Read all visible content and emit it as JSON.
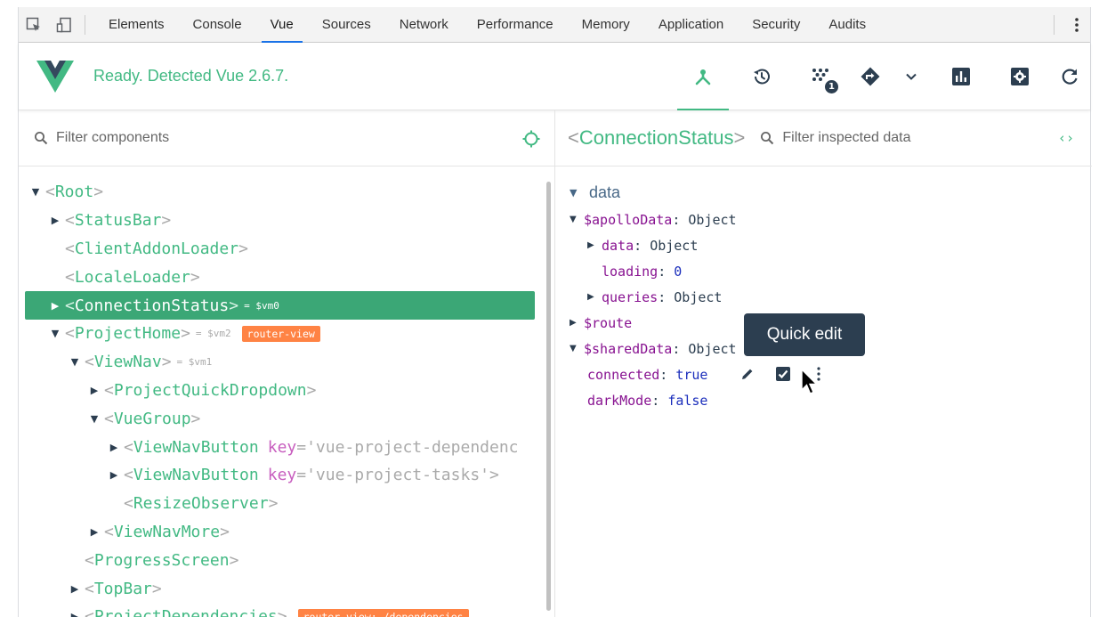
{
  "devtools": {
    "tabs": [
      {
        "label": "Elements"
      },
      {
        "label": "Console"
      },
      {
        "label": "Vue"
      },
      {
        "label": "Sources"
      },
      {
        "label": "Network"
      },
      {
        "label": "Performance"
      },
      {
        "label": "Memory"
      },
      {
        "label": "Application"
      },
      {
        "label": "Security"
      },
      {
        "label": "Audits"
      }
    ],
    "active_tab": "Vue"
  },
  "vue_toolbar": {
    "status": "Ready. Detected Vue 2.6.7.",
    "events_badge": "1",
    "accent": "#42b983"
  },
  "components": {
    "filter_placeholder": "Filter components",
    "tree": [
      {
        "name": "Root",
        "expanded": true
      },
      {
        "name": "StatusBar",
        "expanded": false
      },
      {
        "name": "ClientAddonLoader"
      },
      {
        "name": "LocaleLoader"
      },
      {
        "name": "ConnectionStatus",
        "expanded": false,
        "selected": true,
        "vm": "= $vm0"
      },
      {
        "name": "ProjectHome",
        "expanded": true,
        "vm": "= $vm2",
        "chip": "router-view"
      },
      {
        "name": "ViewNav",
        "expanded": true,
        "vm": "= $vm1"
      },
      {
        "name": "ProjectQuickDropdown",
        "expanded": false
      },
      {
        "name": "VueGroup",
        "expanded": true
      },
      {
        "name": "ViewNavButton",
        "expanded": false,
        "key": "key",
        "key_value": "='vue-project-dependenc"
      },
      {
        "name": "ViewNavButton",
        "expanded": false,
        "key": "key",
        "key_value": "='vue-project-tasks'"
      },
      {
        "name": "ResizeObserver"
      },
      {
        "name": "ViewNavMore",
        "expanded": false
      },
      {
        "name": "ProgressScreen"
      },
      {
        "name": "TopBar",
        "expanded": false
      },
      {
        "name": "ProjectDependencies",
        "expanded": false,
        "chip": "router-view: /dependencies"
      }
    ]
  },
  "inspector": {
    "component_name": "ConnectionStatus",
    "filter_placeholder": "Filter inspected data",
    "section": "data",
    "apollo_key": "$apolloData",
    "apollo_value": "Object",
    "apollo_children": [
      {
        "key": "data",
        "value": "Object"
      },
      {
        "key": "loading",
        "value": "0"
      },
      {
        "key": "queries",
        "value": "Object"
      }
    ],
    "route_key": "$route",
    "shared_key": "$sharedData",
    "shared_value": "Object",
    "shared_children": [
      {
        "key": "connected",
        "value": "true"
      },
      {
        "key": "darkMode",
        "value": "false"
      }
    ],
    "tooltip": "Quick edit"
  }
}
